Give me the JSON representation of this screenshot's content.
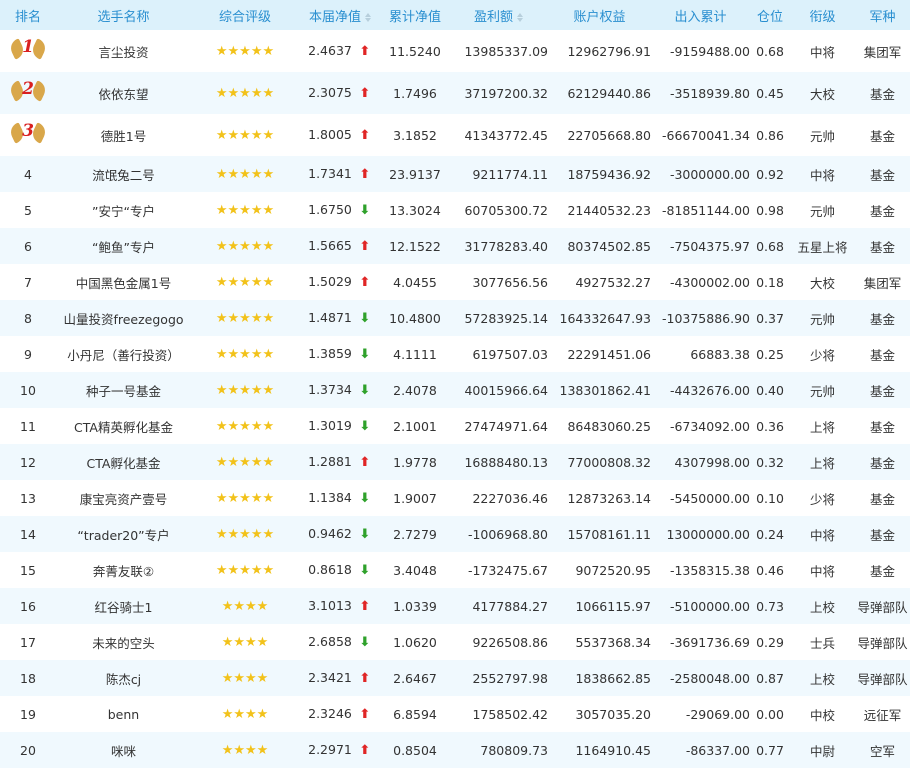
{
  "headers": {
    "rank": "排名",
    "name": "选手名称",
    "rating": "综合评级",
    "nav": "本届净值",
    "cum_nav": "累计净值",
    "profit": "盈利额",
    "equity": "账户权益",
    "flow": "出入累计",
    "position": "仓位",
    "title": "衔级",
    "army": "军种"
  },
  "rows": [
    {
      "rank": "1",
      "name": "言尘投资",
      "stars": "★★★★★",
      "nav": "2.4637",
      "trend": "up",
      "trend_glyph": "⬆",
      "cum_nav": "11.5240",
      "profit": "13985337.09",
      "equity": "12962796.91",
      "flow": "-9159488.00",
      "position": "0.68",
      "title": "中将",
      "army": "集团军"
    },
    {
      "rank": "2",
      "name": "依依东望",
      "stars": "★★★★★",
      "nav": "2.3075",
      "trend": "up",
      "trend_glyph": "⬆",
      "cum_nav": "1.7496",
      "profit": "37197200.32",
      "equity": "62129440.86",
      "flow": "-3518939.80",
      "position": "0.45",
      "title": "大校",
      "army": "基金"
    },
    {
      "rank": "3",
      "name": "德胜1号",
      "stars": "★★★★★",
      "nav": "1.8005",
      "trend": "up",
      "trend_glyph": "⬆",
      "cum_nav": "3.1852",
      "profit": "41343772.45",
      "equity": "22705668.80",
      "flow": "-66670041.34",
      "position": "0.86",
      "title": "元帅",
      "army": "基金"
    },
    {
      "rank": "4",
      "name": "流氓兔二号",
      "stars": "★★★★★",
      "nav": "1.7341",
      "trend": "up",
      "trend_glyph": "⬆",
      "cum_nav": "23.9137",
      "profit": "9211774.11",
      "equity": "18759436.92",
      "flow": "-3000000.00",
      "position": "0.92",
      "title": "中将",
      "army": "基金"
    },
    {
      "rank": "5",
      "name": "”安宁“专户",
      "stars": "★★★★★",
      "nav": "1.6750",
      "trend": "down",
      "trend_glyph": "⬇",
      "cum_nav": "13.3024",
      "profit": "60705300.72",
      "equity": "21440532.23",
      "flow": "-81851144.00",
      "position": "0.98",
      "title": "元帅",
      "army": "基金"
    },
    {
      "rank": "6",
      "name": "“鲍鱼”专户",
      "stars": "★★★★★",
      "nav": "1.5665",
      "trend": "up",
      "trend_glyph": "⬆",
      "cum_nav": "12.1522",
      "profit": "31778283.40",
      "equity": "80374502.85",
      "flow": "-7504375.97",
      "position": "0.68",
      "title": "五星上将",
      "army": "基金"
    },
    {
      "rank": "7",
      "name": "中国黑色金属1号",
      "stars": "★★★★★",
      "nav": "1.5029",
      "trend": "up",
      "trend_glyph": "⬆",
      "cum_nav": "4.0455",
      "profit": "3077656.56",
      "equity": "4927532.27",
      "flow": "-4300002.00",
      "position": "0.18",
      "title": "大校",
      "army": "集团军"
    },
    {
      "rank": "8",
      "name": "山量投资freezegogo",
      "stars": "★★★★★",
      "nav": "1.4871",
      "trend": "down",
      "trend_glyph": "⬇",
      "cum_nav": "10.4800",
      "profit": "57283925.14",
      "equity": "164332647.93",
      "flow": "-10375886.90",
      "position": "0.37",
      "title": "元帅",
      "army": "基金"
    },
    {
      "rank": "9",
      "name": "小丹尼（善行投资）",
      "stars": "★★★★★",
      "nav": "1.3859",
      "trend": "down",
      "trend_glyph": "⬇",
      "cum_nav": "4.1111",
      "profit": "6197507.03",
      "equity": "22291451.06",
      "flow": "66883.38",
      "position": "0.25",
      "title": "少将",
      "army": "基金"
    },
    {
      "rank": "10",
      "name": "种子一号基金",
      "stars": "★★★★★",
      "nav": "1.3734",
      "trend": "down",
      "trend_glyph": "⬇",
      "cum_nav": "2.4078",
      "profit": "40015966.64",
      "equity": "138301862.41",
      "flow": "-4432676.00",
      "position": "0.40",
      "title": "元帅",
      "army": "基金"
    },
    {
      "rank": "11",
      "name": "CTA精英孵化基金",
      "stars": "★★★★★",
      "nav": "1.3019",
      "trend": "down",
      "trend_glyph": "⬇",
      "cum_nav": "2.1001",
      "profit": "27474971.64",
      "equity": "86483060.25",
      "flow": "-6734092.00",
      "position": "0.36",
      "title": "上将",
      "army": "基金"
    },
    {
      "rank": "12",
      "name": "CTA孵化基金",
      "stars": "★★★★★",
      "nav": "1.2881",
      "trend": "up",
      "trend_glyph": "⬆",
      "cum_nav": "1.9778",
      "profit": "16888480.13",
      "equity": "77000808.32",
      "flow": "4307998.00",
      "position": "0.32",
      "title": "上将",
      "army": "基金"
    },
    {
      "rank": "13",
      "name": "康宝亮资产壹号",
      "stars": "★★★★★",
      "nav": "1.1384",
      "trend": "down",
      "trend_glyph": "⬇",
      "cum_nav": "1.9007",
      "profit": "2227036.46",
      "equity": "12873263.14",
      "flow": "-5450000.00",
      "position": "0.10",
      "title": "少将",
      "army": "基金"
    },
    {
      "rank": "14",
      "name": "“trader20”专户",
      "stars": "★★★★★",
      "nav": "0.9462",
      "trend": "down",
      "trend_glyph": "⬇",
      "cum_nav": "2.7279",
      "profit": "-1006968.80",
      "equity": "15708161.11",
      "flow": "13000000.00",
      "position": "0.24",
      "title": "中将",
      "army": "基金"
    },
    {
      "rank": "15",
      "name": "奔菁友联②",
      "stars": "★★★★★",
      "nav": "0.8618",
      "trend": "down",
      "trend_glyph": "⬇",
      "cum_nav": "3.4048",
      "profit": "-1732475.67",
      "equity": "9072520.95",
      "flow": "-1358315.38",
      "position": "0.46",
      "title": "中将",
      "army": "基金"
    },
    {
      "rank": "16",
      "name": "红谷骑士1",
      "stars": "★★★★",
      "nav": "3.1013",
      "trend": "up",
      "trend_glyph": "⬆",
      "cum_nav": "1.0339",
      "profit": "4177884.27",
      "equity": "1066115.97",
      "flow": "-5100000.00",
      "position": "0.73",
      "title": "上校",
      "army": "导弹部队"
    },
    {
      "rank": "17",
      "name": "未来的空头",
      "stars": "★★★★",
      "nav": "2.6858",
      "trend": "down",
      "trend_glyph": "⬇",
      "cum_nav": "1.0620",
      "profit": "9226508.86",
      "equity": "5537368.34",
      "flow": "-3691736.69",
      "position": "0.29",
      "title": "士兵",
      "army": "导弹部队"
    },
    {
      "rank": "18",
      "name": "陈杰cj",
      "stars": "★★★★",
      "nav": "2.3421",
      "trend": "up",
      "trend_glyph": "⬆",
      "cum_nav": "2.6467",
      "profit": "2552797.98",
      "equity": "1838662.85",
      "flow": "-2580048.00",
      "position": "0.87",
      "title": "上校",
      "army": "导弹部队"
    },
    {
      "rank": "19",
      "name": "benn",
      "stars": "★★★★",
      "nav": "2.3246",
      "trend": "up",
      "trend_glyph": "⬆",
      "cum_nav": "6.8594",
      "profit": "1758502.42",
      "equity": "3057035.20",
      "flow": "-29069.00",
      "position": "0.00",
      "title": "中校",
      "army": "远征军"
    },
    {
      "rank": "20",
      "name": "咪咪",
      "stars": "★★★★",
      "nav": "2.2971",
      "trend": "up",
      "trend_glyph": "⬆",
      "cum_nav": "0.8504",
      "profit": "780809.73",
      "equity": "1164910.45",
      "flow": "-86337.00",
      "position": "0.77",
      "title": "中尉",
      "army": "空军"
    }
  ],
  "colors": {
    "header_bg": "#dcf1fb",
    "header_text": "#2a8fd0",
    "row_alt": "#f0f9fe",
    "star": "#f2c21a",
    "up": "#e02525",
    "down": "#2fa12b",
    "medal_number": "#d92020"
  }
}
